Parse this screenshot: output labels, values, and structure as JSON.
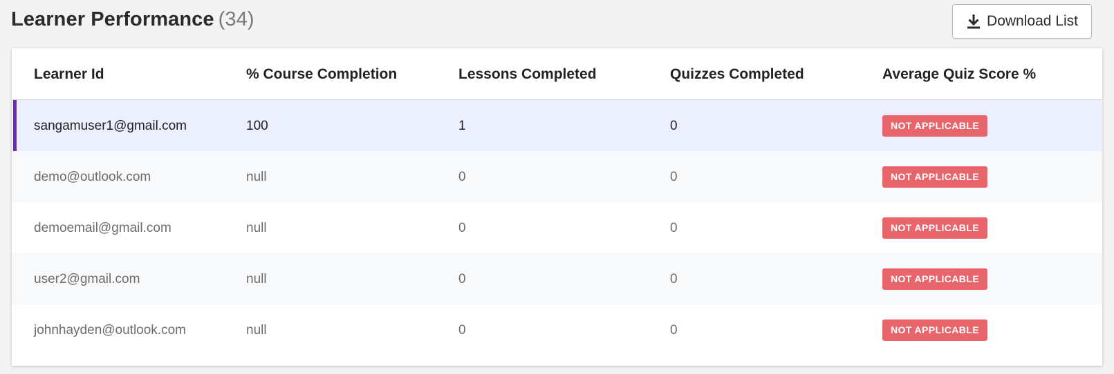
{
  "header": {
    "title": "Learner Performance",
    "count": "(34)",
    "download_label": "Download List",
    "download_icon": "download-icon"
  },
  "table": {
    "columns": [
      "Learner Id",
      "% Course Completion",
      "Lessons Completed",
      "Quizzes Completed",
      "Average Quiz Score %"
    ],
    "rows": [
      {
        "learner_id": "sangamuser1@gmail.com",
        "course_completion": "100",
        "lessons": "1",
        "quizzes": "0",
        "avg_score": "NOT APPLICABLE"
      },
      {
        "learner_id": "demo@outlook.com",
        "course_completion": "null",
        "lessons": "0",
        "quizzes": "0",
        "avg_score": "NOT APPLICABLE"
      },
      {
        "learner_id": "demoemail@gmail.com",
        "course_completion": "null",
        "lessons": "0",
        "quizzes": "0",
        "avg_score": "NOT APPLICABLE"
      },
      {
        "learner_id": "user2@gmail.com",
        "course_completion": "null",
        "lessons": "0",
        "quizzes": "0",
        "avg_score": "NOT APPLICABLE"
      },
      {
        "learner_id": "johnhayden@outlook.com",
        "course_completion": "null",
        "lessons": "0",
        "quizzes": "0",
        "avg_score": "NOT APPLICABLE"
      }
    ]
  },
  "colors": {
    "selected_row_bg": "#ecf0fe",
    "selected_accent": "#7227b5",
    "alt_row_bg": "#f8f9fb",
    "badge_bg": "#e8666b",
    "page_bg": "#f3f3f3"
  }
}
